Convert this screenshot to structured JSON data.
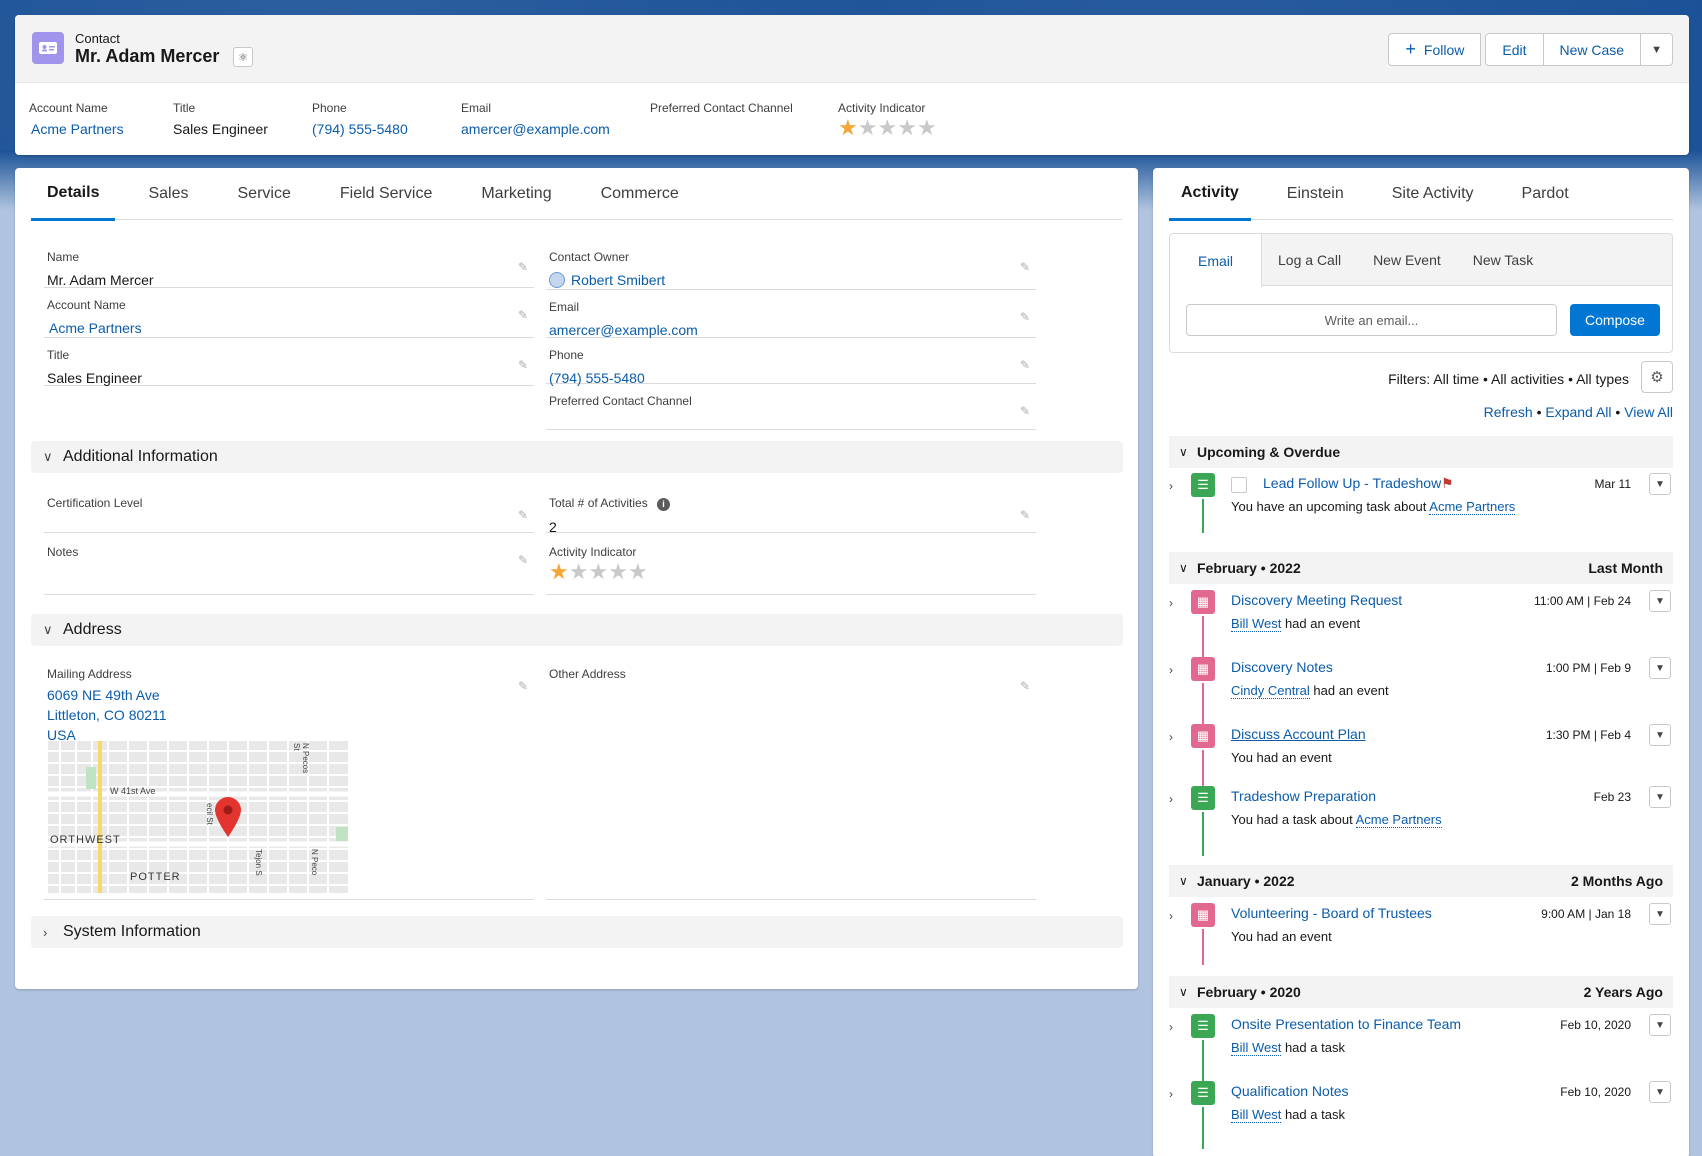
{
  "header": {
    "object_type": "Contact",
    "name": "Mr. Adam Mercer",
    "buttons": {
      "follow": "Follow",
      "edit": "Edit",
      "new_case": "New Case"
    },
    "highlights": [
      {
        "label": "Account Name",
        "value": "Acme Partners"
      },
      {
        "label": "Title",
        "value": "Sales Engineer"
      },
      {
        "label": "Phone",
        "value": "(794) 555-5480"
      },
      {
        "label": "Email",
        "value": "amercer@example.com"
      },
      {
        "label": "Preferred Contact Channel",
        "value": ""
      },
      {
        "label": "Activity Indicator",
        "value": ""
      }
    ],
    "activity_rating": 1
  },
  "tabs": [
    "Details",
    "Sales",
    "Service",
    "Field Service",
    "Marketing",
    "Commerce"
  ],
  "details": {
    "name_label": "Name",
    "name": "Mr. Adam Mercer",
    "account_label": "Account Name",
    "account": "Acme Partners",
    "title_label": "Title",
    "title": "Sales Engineer",
    "owner_label": "Contact Owner",
    "owner": "Robert Smibert",
    "email_label": "Email",
    "email": "amercer@example.com",
    "phone_label": "Phone",
    "phone": "(794) 555-5480",
    "pref_label": "Preferred Contact Channel",
    "pref": ""
  },
  "sections": {
    "additional": "Additional Information",
    "address": "Address",
    "system": "System Information"
  },
  "additional": {
    "cert_label": "Certification Level",
    "cert": "",
    "notes_label": "Notes",
    "notes": "",
    "total_label": "Total # of Activities",
    "total": "2",
    "indicator_label": "Activity Indicator"
  },
  "address": {
    "mailing_label": "Mailing Address",
    "line1": "6069 NE 49th Ave",
    "line2": "Littleton, CO 80211",
    "line3": "USA",
    "other_label": "Other Address",
    "map_labels": {
      "street1": "W 41st Ave",
      "street2": "N Pecos St",
      "area1": "ORTHWEST",
      "area2": "POTTER",
      "street3": "Tejon S",
      "street4": "N Peco",
      "street5": "ecil St"
    }
  },
  "side": {
    "tabs": [
      "Activity",
      "Einstein",
      "Site Activity",
      "Pardot"
    ],
    "publisher_tabs": [
      "Email",
      "Log a Call",
      "New Event",
      "New Task"
    ],
    "email_placeholder": "Write an email...",
    "compose": "Compose",
    "filters": "Filters: All time • All activities • All types",
    "links": {
      "refresh": "Refresh",
      "expand": "Expand All",
      "view": "View All",
      "sep": "•"
    },
    "groups": [
      {
        "title": "Upcoming & Overdue",
        "right": ""
      },
      {
        "title": "February • 2022",
        "right": "Last Month"
      },
      {
        "title": "January • 2022",
        "right": "2 Months Ago"
      },
      {
        "title": "February • 2020",
        "right": "2 Years Ago"
      }
    ],
    "items": [
      {
        "title": "Lead Follow Up - Tradeshow",
        "sub_pre": "You have an upcoming task about",
        "sub_link": "Acme Partners",
        "sub_post": "",
        "date": "Mar 11"
      },
      {
        "title": "Discovery Meeting Request",
        "sub_pre": "",
        "sub_link": "Bill West",
        "sub_post": "had an event",
        "date": "11:00 AM | Feb 24"
      },
      {
        "title": "Discovery Notes",
        "sub_pre": "",
        "sub_link": "Cindy Central",
        "sub_post": "had an event",
        "date": "1:00 PM | Feb 9"
      },
      {
        "title": "Discuss Account Plan",
        "sub_pre": "You had an event",
        "sub_link": "",
        "sub_post": "",
        "date": "1:30 PM | Feb 4"
      },
      {
        "title": "Tradeshow Preparation",
        "sub_pre": "You had a task about",
        "sub_link": "Acme Partners",
        "sub_post": "",
        "date": "Feb 23"
      },
      {
        "title": "Volunteering - Board of Trustees",
        "sub_pre": "You had an event",
        "sub_link": "",
        "sub_post": "",
        "date": "9:00 AM | Jan 18"
      },
      {
        "title": "Onsite Presentation to Finance Team",
        "sub_pre": "",
        "sub_link": "Bill West",
        "sub_post": "had a task",
        "date": "Feb 10, 2020"
      },
      {
        "title": "Qualification Notes",
        "sub_pre": "",
        "sub_link": "Bill West",
        "sub_post": "had a task",
        "date": "Feb 10, 2020"
      }
    ]
  }
}
